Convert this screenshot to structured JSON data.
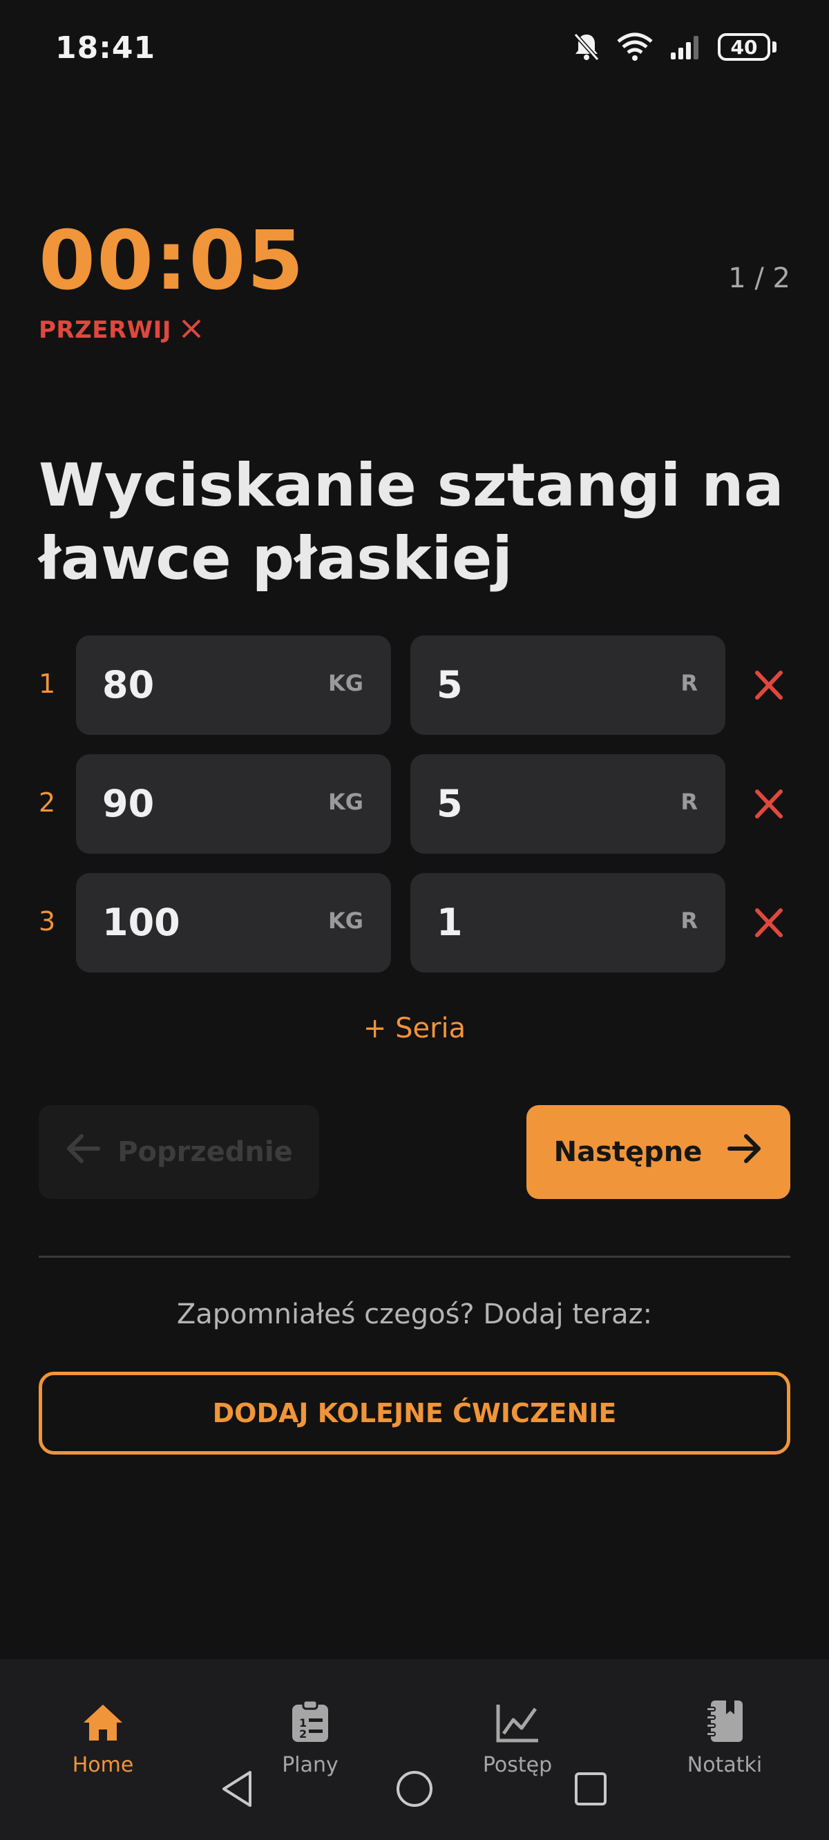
{
  "status_bar": {
    "time": "18:41",
    "icons": [
      "bell-off-icon",
      "wifi-icon",
      "signal-icon"
    ],
    "battery": "40"
  },
  "timer": {
    "value": "00:05",
    "cancel_label": "PRZERWIJ",
    "cancel_icon": "close-icon"
  },
  "pager": "1 / 2",
  "exercise": {
    "title": "Wyciskanie sztangi na ławce płaskiej"
  },
  "sets": [
    {
      "number": "1",
      "weight": "80",
      "weight_unit": "KG",
      "reps": "5",
      "reps_unit": "R"
    },
    {
      "number": "2",
      "weight": "90",
      "weight_unit": "KG",
      "reps": "5",
      "reps_unit": "R"
    },
    {
      "number": "3",
      "weight": "100",
      "weight_unit": "KG",
      "reps": "1",
      "reps_unit": "R"
    }
  ],
  "add_set_label": "+ Seria",
  "buttons": {
    "previous": "Poprzednie",
    "next": "Następne"
  },
  "forgot_text": "Zapomniałeś czegoś? Dodaj teraz:",
  "add_exercise_label": "DODAJ KOLEJNE ĆWICZENIE",
  "bottom_nav": [
    {
      "label": "Home",
      "icon": "home-icon",
      "active": true
    },
    {
      "label": "Plany",
      "icon": "clipboard-list-icon",
      "active": false
    },
    {
      "label": "Postęp",
      "icon": "chart-line-icon",
      "active": false
    },
    {
      "label": "Notatki",
      "icon": "notebook-icon",
      "active": false
    }
  ],
  "system_nav": [
    "back-icon",
    "home-circle-icon",
    "recents-icon"
  ],
  "colors": {
    "background": "#121212",
    "accent": "#f0953a",
    "danger": "#e0483e",
    "field": "#2a2a2d",
    "nav_bg": "#1c1c1e"
  }
}
